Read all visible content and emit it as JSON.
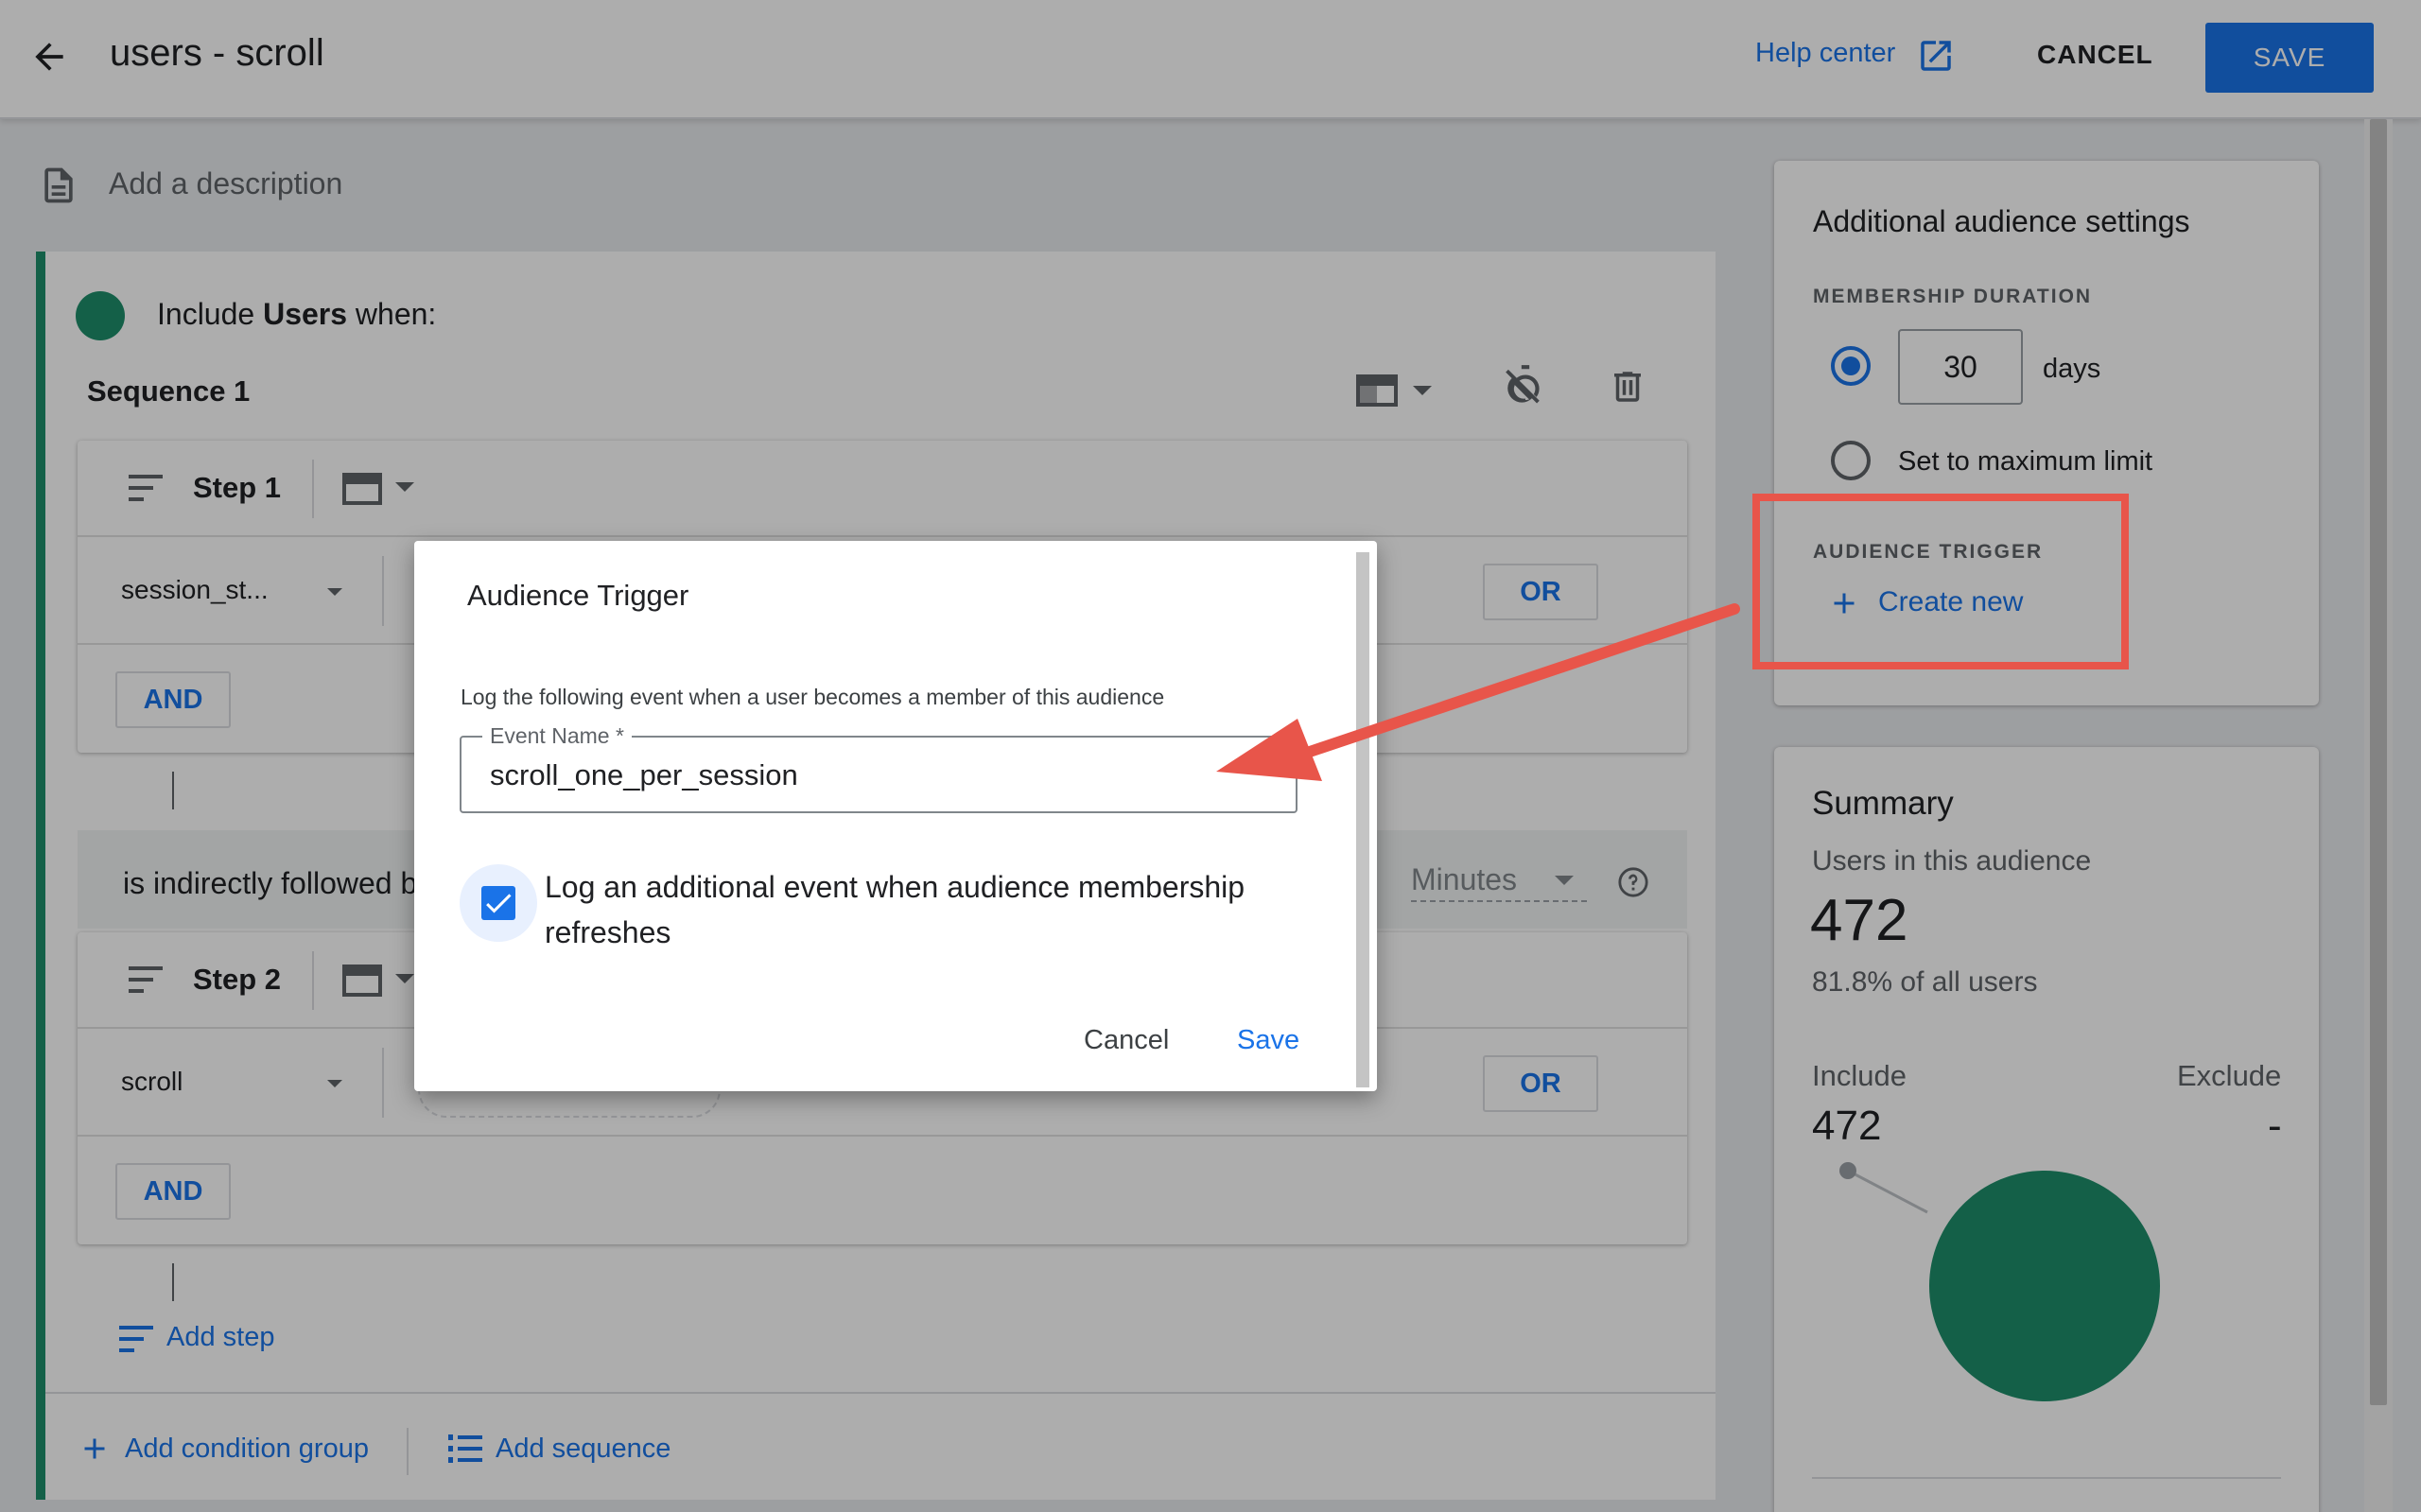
{
  "header": {
    "title": "users - scroll",
    "help_label": "Help center",
    "cancel_label": "CANCEL",
    "save_label": "SAVE"
  },
  "description_placeholder": "Add a description",
  "condition_group": {
    "include_prefix": "Include",
    "include_target": "Users",
    "include_suffix": "when:",
    "sequence_title": "Sequence 1",
    "steps": [
      {
        "title": "Step 1",
        "event": "session_st...",
        "or_label": "OR",
        "and_label": "AND"
      },
      {
        "title": "Step 2",
        "event": "scroll",
        "or_label": "OR",
        "and_label": "AND"
      }
    ],
    "followed_text": "is indirectly followed b",
    "time_unit": "Minutes",
    "add_step_label": "Add step",
    "add_condition_group_label": "Add condition group",
    "add_sequence_label": "Add sequence"
  },
  "settings": {
    "title": "Additional audience settings",
    "membership_duration_label": "MEMBERSHIP DURATION",
    "duration_value": "30",
    "duration_unit": "days",
    "max_limit_label": "Set to maximum limit",
    "trigger_label": "AUDIENCE TRIGGER",
    "create_new_label": "Create new"
  },
  "summary": {
    "title": "Summary",
    "users_label": "Users in this audience",
    "users_count": "472",
    "percent_text": "81.8% of all users",
    "include_label": "Include",
    "exclude_label": "Exclude",
    "include_value": "472",
    "exclude_value": "-"
  },
  "dialog": {
    "title": "Audience Trigger",
    "description": "Log the following event when a user becomes a member of this audience",
    "field_label": "Event Name *",
    "field_value": "scroll_one_per_session",
    "checkbox_label": "Log an additional event when audience membership refreshes",
    "checkbox_checked": true,
    "cancel_label": "Cancel",
    "save_label": "Save"
  },
  "colors": {
    "accent": "#1a73e8",
    "green": "#1e8e6a",
    "annotation": "#e8554a"
  }
}
